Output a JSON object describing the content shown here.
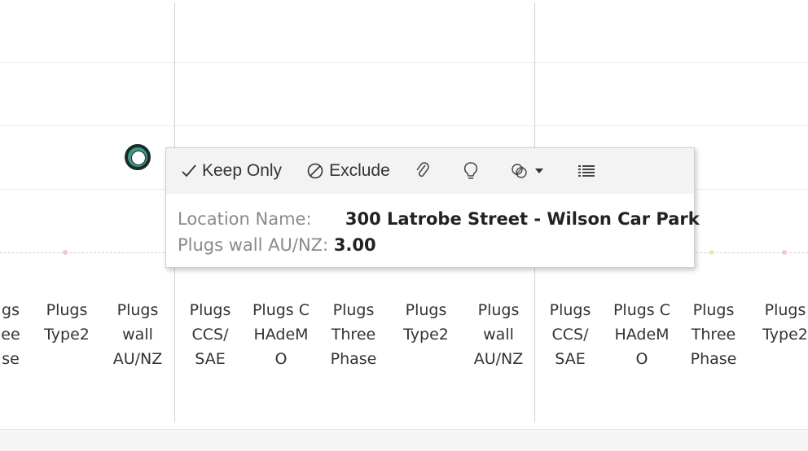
{
  "tooltip": {
    "actions": {
      "keep_only": "Keep Only",
      "exclude": "Exclude"
    },
    "icons": [
      "checkmark-icon",
      "exclude-icon",
      "paperclip-icon",
      "lightbulb-icon",
      "group-members-icon",
      "chevron-down-icon",
      "view-data-icon"
    ],
    "fields": [
      {
        "label": "Location Name:",
        "value": "300 Latrobe Street - Wilson Car Park"
      },
      {
        "label": "Plugs wall AU/NZ:",
        "value": "3.00"
      }
    ]
  },
  "column_headers": [
    {
      "text": "gs\nee\nse"
    },
    {
      "text": "Plugs\nType2"
    },
    {
      "text": "Plugs\nwall\nAU/NZ"
    },
    {
      "text": "Plugs\nCCS/\nSAE"
    },
    {
      "text": "Plugs C\nHAdeM\nO"
    },
    {
      "text": "Plugs\nThree\nPhase"
    },
    {
      "text": "Plugs\nType2"
    },
    {
      "text": "Plugs\nwall\nAU/NZ"
    },
    {
      "text": "Plugs\nCCS/\nSAE"
    },
    {
      "text": "Plugs C\nHAdeM\nO"
    },
    {
      "text": "Plugs\nThree\nPhase"
    },
    {
      "text": "Plugs\nType2"
    }
  ],
  "colors": {
    "marker_fill": "#3b9c88",
    "marker_ring": "#1b2a2a",
    "baseline_dot_pink": "#f4c7cc",
    "baseline_dot_yellow": "#f2e6b8"
  }
}
